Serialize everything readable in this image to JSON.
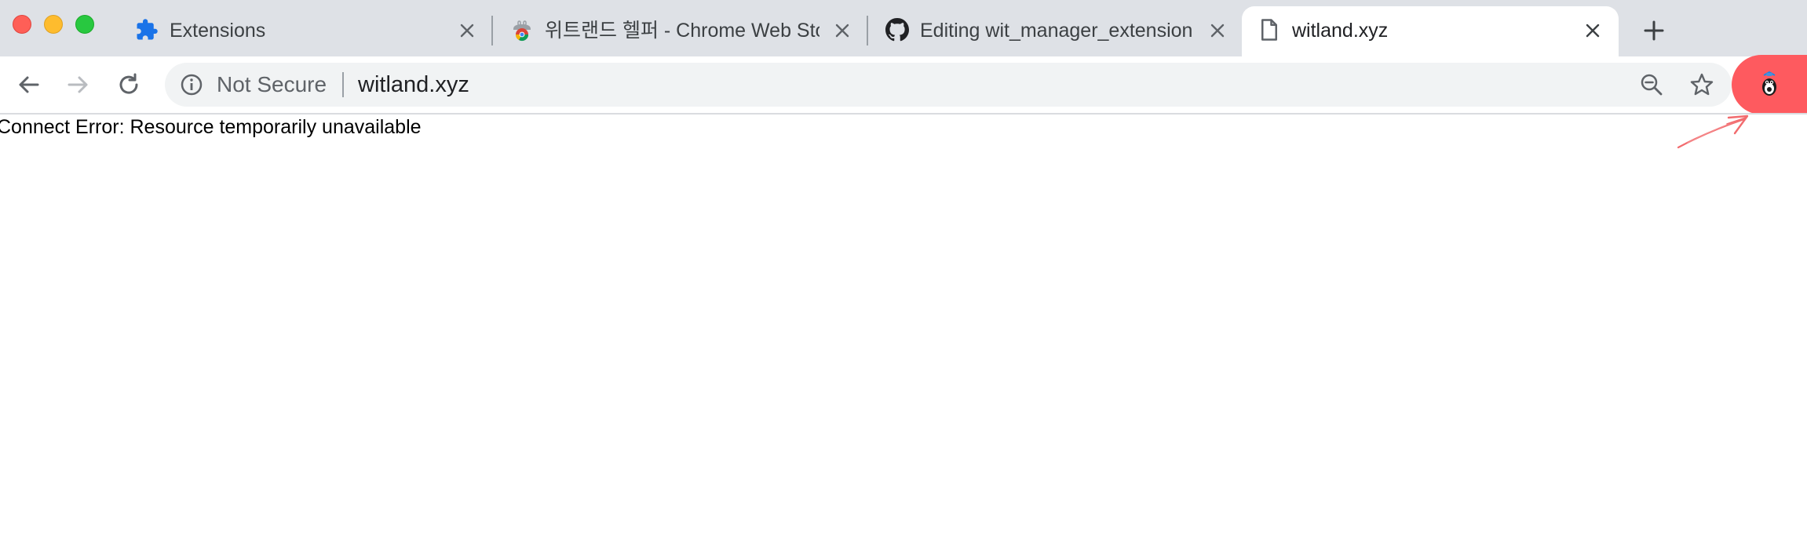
{
  "tabs": [
    {
      "title": "Extensions",
      "icon": "puzzle-icon",
      "active": false
    },
    {
      "title": "위트랜드 헬퍼 - Chrome Web Sto",
      "icon": "chrome-web-store-icon",
      "active": false
    },
    {
      "title": "Editing wit_manager_extension",
      "icon": "github-icon",
      "active": false
    },
    {
      "title": "witland.xyz",
      "icon": "page-icon",
      "active": true
    }
  ],
  "omnibox": {
    "security_label": "Not Secure",
    "url": "witland.xyz"
  },
  "page": {
    "error_message": "Connect Error: Resource temporarily unavailable"
  },
  "colors": {
    "highlight": "#fe5a5f",
    "tabbar": "#dee1e6",
    "extensions_icon": "#1a73e8"
  }
}
